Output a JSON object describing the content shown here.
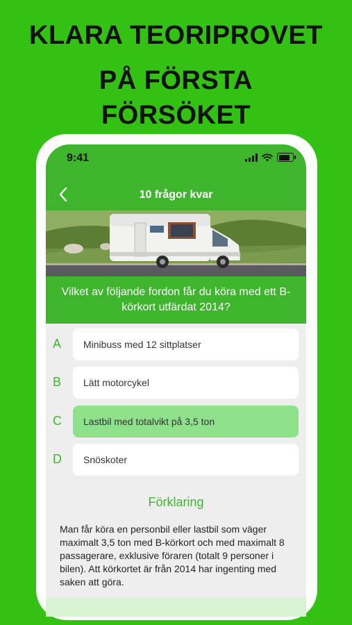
{
  "promo": {
    "line1": "KLARA TEORIPROVET",
    "line2": "PÅ FÖRSTA",
    "line3": "FÖRSÖKET"
  },
  "status_bar": {
    "time": "9:41"
  },
  "nav": {
    "title": "10 frågor kvar"
  },
  "question": {
    "text": "Vilket av följande fordon får du köra med ett B-körkort utfärdat 2014?"
  },
  "answers": [
    {
      "letter": "A",
      "text": "Minibuss med 12 sittplatser"
    },
    {
      "letter": "B",
      "text": "Lätt motorcykel"
    },
    {
      "letter": "C",
      "text": "Lastbil med totalvikt på 3,5 ton"
    },
    {
      "letter": "D",
      "text": "Snöskoter"
    }
  ],
  "explanation": {
    "title": "Förklaring",
    "text": "Man får köra en personbil eller lastbil som väger maximalt 3,5 ton med B-körkort och med maximalt 8 passagerare, exklusive föraren (totalt 9 personer i bilen). Att körkortet är från 2014 har ingenting med saken att göra."
  },
  "colors": {
    "background": "#33c214",
    "accent": "#3fb52e",
    "selected": "#8fe08a"
  }
}
